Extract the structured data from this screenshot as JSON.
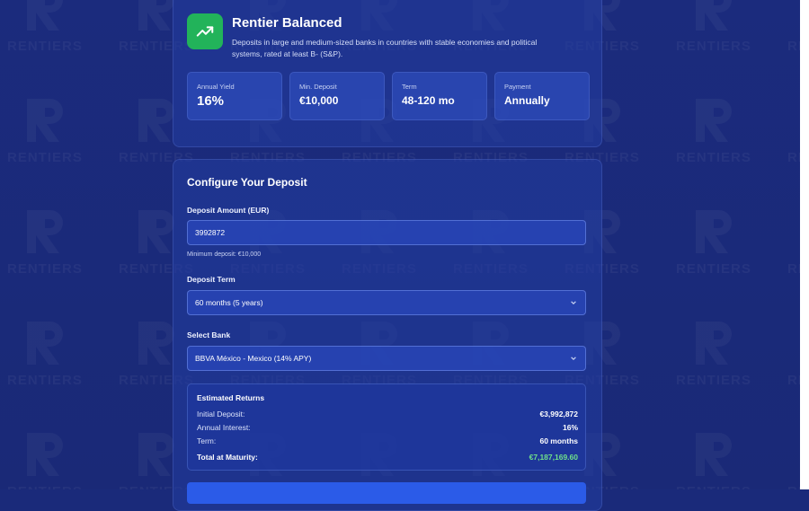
{
  "watermark": {
    "text": "RENTIERS"
  },
  "product": {
    "title": "Rentier Balanced",
    "icon": "trending-up-icon",
    "description": "Deposits in large and medium-sized banks in countries with stable economies and political systems, rated at least B- (S&P).",
    "stats": [
      {
        "label": "Annual Yield",
        "value": "16%"
      },
      {
        "label": "Min. Deposit",
        "value": "€10,000"
      },
      {
        "label": "Term",
        "value": "48-120 mo"
      },
      {
        "label": "Payment",
        "value": "Annually"
      }
    ]
  },
  "config": {
    "title": "Configure Your Deposit",
    "amount": {
      "label": "Deposit Amount (EUR)",
      "value": "3992872",
      "hint": "Minimum deposit: €10,000"
    },
    "term": {
      "label": "Deposit Term",
      "selected": "60 months (5 years)"
    },
    "bank": {
      "label": "Select Bank",
      "selected": "BBVA México - Mexico (14% APY)"
    }
  },
  "returns": {
    "title": "Estimated Returns",
    "rows": [
      {
        "label": "Initial Deposit:",
        "value": "€3,992,872"
      },
      {
        "label": "Annual Interest:",
        "value": "16%"
      },
      {
        "label": "Term:",
        "value": "60 months"
      }
    ],
    "total": {
      "label": "Total at Maturity:",
      "value": "€7,187,169.60"
    }
  },
  "colors": {
    "accent": "#2b5be8",
    "success": "#22b35a",
    "total": "#6fe08a",
    "background": "#1a2a7a"
  }
}
